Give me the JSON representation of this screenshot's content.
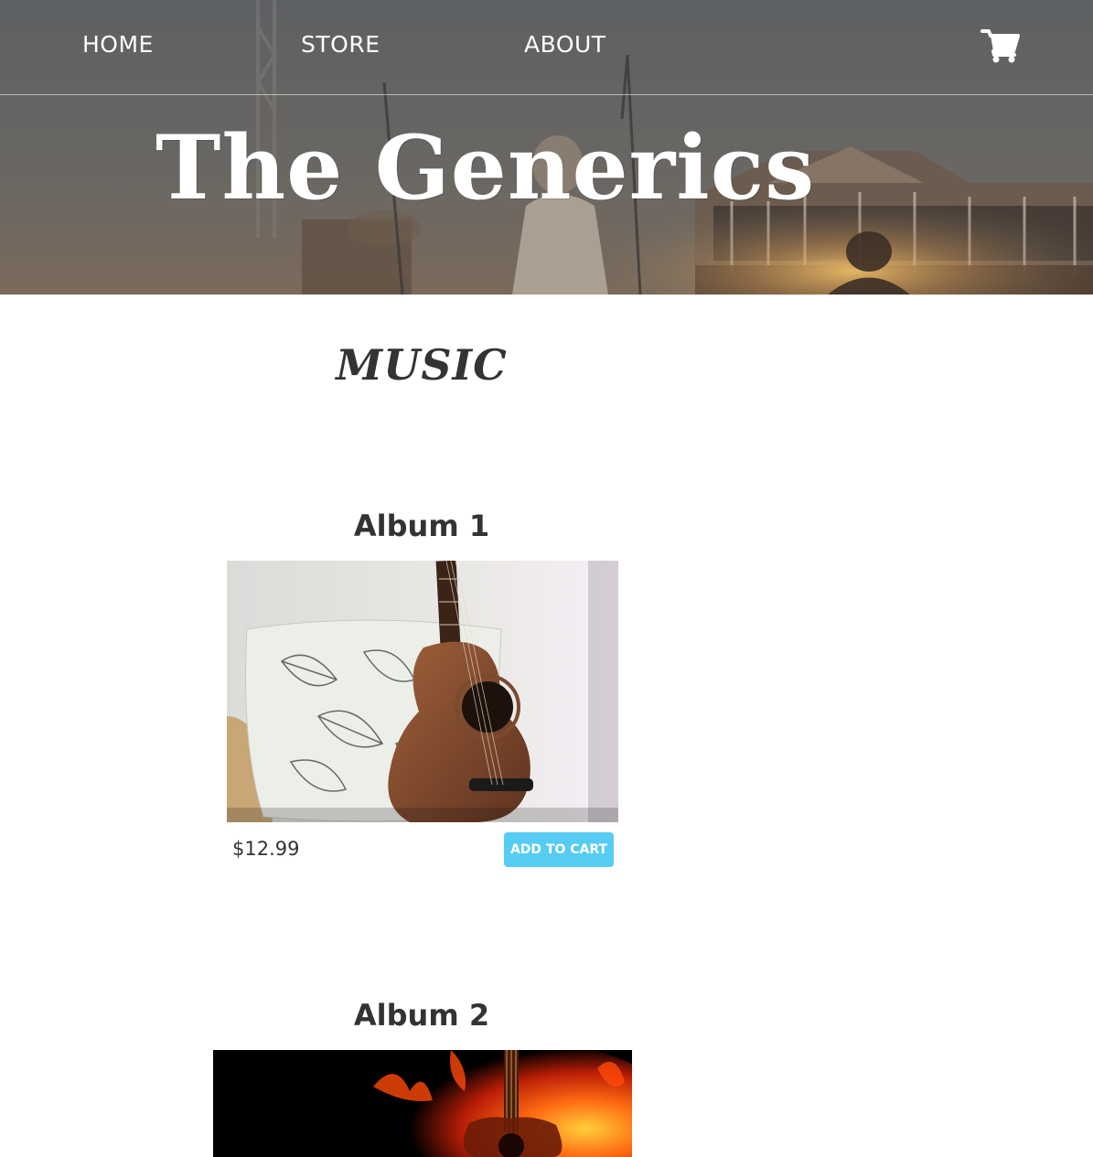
{
  "nav": {
    "home_label": "HOME",
    "store_label": "STORE",
    "about_label": "ABOUT",
    "cart_icon": "shopping-cart-icon"
  },
  "header": {
    "title": "The Generics"
  },
  "main": {
    "section_title": "MUSIC",
    "albums": [
      {
        "title": "Album 1",
        "image": "acoustic-guitar-on-pillow",
        "price": "$12.99",
        "button_label": "ADD TO CART"
      },
      {
        "title": "Album 2",
        "image": "guitar-on-fire"
      }
    ]
  },
  "colors": {
    "accent": "#56ccf2",
    "text": "#333333",
    "header_overlay": "#5b5e62"
  }
}
